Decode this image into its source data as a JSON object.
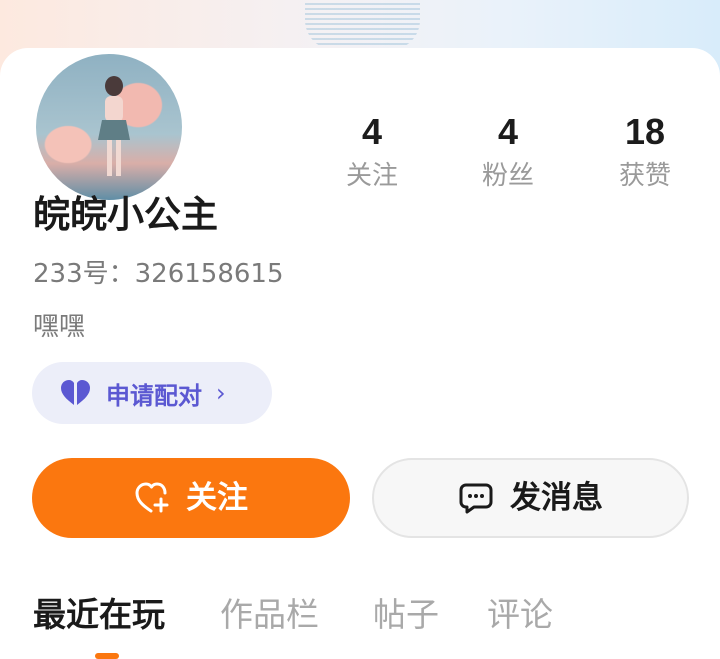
{
  "profile": {
    "name": "皖皖小公主",
    "uid_text": "233号：326158615",
    "bio": "嘿嘿"
  },
  "stats": [
    {
      "value": "4",
      "label": "关注"
    },
    {
      "value": "4",
      "label": "粉丝"
    },
    {
      "value": "18",
      "label": "获赞"
    }
  ],
  "pair_button": {
    "label": "申请配对",
    "chevron": "›",
    "icon": "heart-pair-icon"
  },
  "actions": {
    "follow_label": "关注",
    "follow_icon": "heart-plus-icon",
    "message_label": "发消息",
    "message_icon": "chat-bubble-icon"
  },
  "tabs": [
    {
      "label": "最近在玩",
      "active": true
    },
    {
      "label": "作品栏",
      "active": false
    },
    {
      "label": "帖子",
      "active": false
    },
    {
      "label": "评论",
      "active": false
    }
  ],
  "colors": {
    "accent": "#fb770f",
    "pair_text": "#5b58d2",
    "pair_bg": "#eceef9"
  }
}
